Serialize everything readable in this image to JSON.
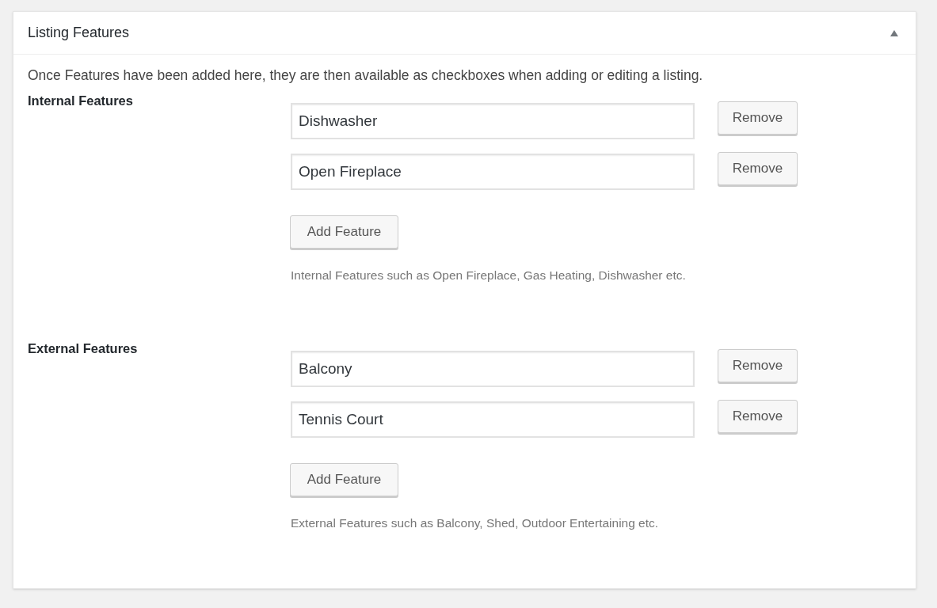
{
  "panel": {
    "title": "Listing Features",
    "expanded": true
  },
  "description": "Once Features have been added here, they are then available as checkboxes when adding or editing a listing.",
  "sections": [
    {
      "label": "Internal Features",
      "features": [
        {
          "value": "Dishwasher",
          "remove": "Remove"
        },
        {
          "value": "Open Fireplace",
          "remove": "Remove"
        }
      ],
      "add_button": "Add Feature",
      "help": "Internal Features such as Open Fireplace, Gas Heating, Dishwasher etc."
    },
    {
      "label": "External Features",
      "features": [
        {
          "value": "Balcony",
          "remove": "Remove"
        },
        {
          "value": "Tennis Court",
          "remove": "Remove"
        }
      ],
      "add_button": "Add Feature",
      "help": "External Features such as Balcony, Shed, Outdoor Entertaining etc."
    }
  ]
}
